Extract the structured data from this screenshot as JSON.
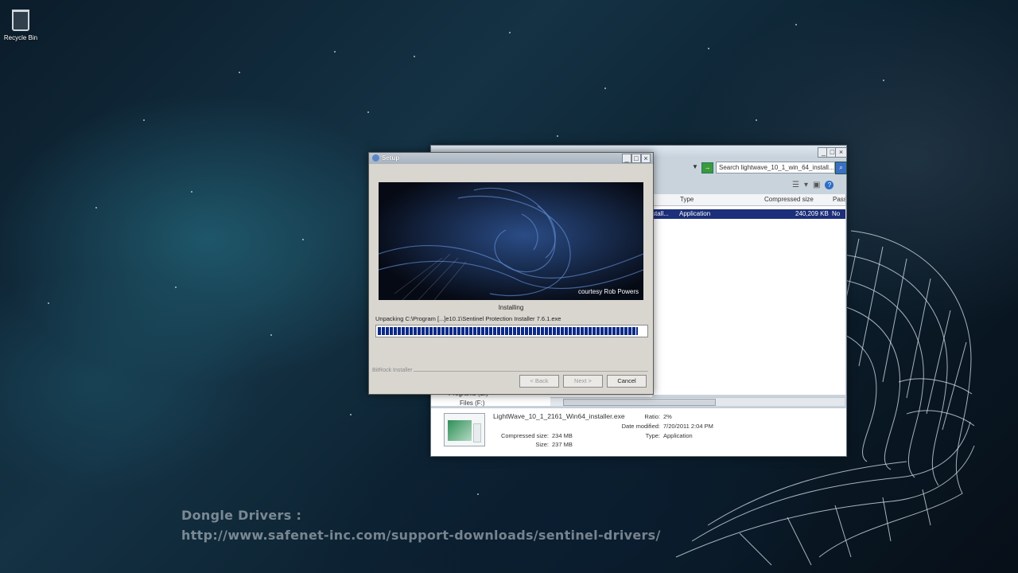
{
  "desktop": {
    "recycle_bin_label": "Recycle Bin"
  },
  "overlay": {
    "line1": "Dongle Drivers :",
    "line2": "http://www.safenet-inc.com/support-downloads/sentinel-drivers/"
  },
  "archive_window": {
    "search_placeholder": "Search lightwave_10_1_win_64_install...",
    "columns": [
      "Type",
      "Compressed size",
      "Passw"
    ],
    "row": {
      "name_fragment": "stall...",
      "type": "Application",
      "compressed_size": "240,209 KB",
      "password": "No"
    },
    "nav_items": [
      "Programs (E:)",
      "Files (F:)"
    ],
    "details": {
      "filename": "LightWave_10_1_2161_Win64_installer.exe",
      "compressed_size_label": "Compressed size:",
      "compressed_size": "234 MB",
      "size_label": "Size:",
      "size": "237 MB",
      "ratio_label": "Ratio:",
      "ratio": "2%",
      "date_modified_label": "Date modified:",
      "date_modified": "7/20/2011 2:04 PM",
      "type_label": "Type:",
      "type": "Application"
    },
    "colors": {
      "selection": "#1c2f7a"
    }
  },
  "setup_dialog": {
    "title": "Setup",
    "banner_credit": "courtesy Rob Powers",
    "status": "Installing",
    "unpacking_text": "Unpacking C:\\Program [...]e10.1\\Sentinel Protection Installer 7.6.1.exe",
    "progress": 0.97,
    "footer_brand": "BitRock Installer",
    "buttons": {
      "back": "< Back",
      "next": "Next >",
      "cancel": "Cancel"
    },
    "colors": {
      "progress_fill": "#0b2a8a"
    }
  }
}
